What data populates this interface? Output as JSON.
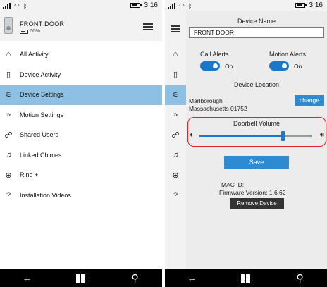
{
  "status_bar": {
    "time": "3:16",
    "icons": [
      "signal-icon",
      "wifi-icon",
      "bluetooth-icon",
      "battery-icon"
    ]
  },
  "left": {
    "device": {
      "name": "FRONT DOOR",
      "battery": "55%"
    },
    "menu": [
      {
        "label": "All Activity",
        "icon": "home-icon",
        "glyph": "⌂",
        "active": false
      },
      {
        "label": "Device Activity",
        "icon": "doorbell-icon",
        "glyph": "▯",
        "active": false
      },
      {
        "label": "Device Settings",
        "icon": "sliders-icon",
        "glyph": "⚟",
        "active": true
      },
      {
        "label": "Motion Settings",
        "icon": "motion-icon",
        "glyph": "»",
        "active": false
      },
      {
        "label": "Shared Users",
        "icon": "users-icon",
        "glyph": "☍",
        "active": false
      },
      {
        "label": "Linked Chimes",
        "icon": "music-note-icon",
        "glyph": "♫",
        "active": false
      },
      {
        "label": "Ring +",
        "icon": "add-circle-icon",
        "glyph": "⊕",
        "active": false
      },
      {
        "label": "Installation Videos",
        "icon": "help-icon",
        "glyph": "?",
        "active": false
      }
    ]
  },
  "right": {
    "device_name_label": "Device Name",
    "device_name_value": "FRONT DOOR",
    "call_alerts": {
      "label": "Call Alerts",
      "state": "On"
    },
    "motion_alerts": {
      "label": "Motion Alerts",
      "state": "On"
    },
    "device_location_label": "Device Location",
    "location_line1": "Marlborough",
    "location_line2": "Massachusetts 01752",
    "change_label": "change",
    "doorbell_volume_label": "Doorbell Volume",
    "doorbell_volume_level": 0.74,
    "save_label": "Save",
    "mac_id": "MAC ID:",
    "firmware": "Firmware Version: 1.6.62",
    "remove_label": "Remove Device"
  },
  "nav": {
    "back_glyph": "←",
    "search_glyph": "⚲"
  },
  "colors": {
    "accent": "#2e8bd1",
    "active_row": "#8ec0e4",
    "highlight_ring": "#d9262c"
  }
}
